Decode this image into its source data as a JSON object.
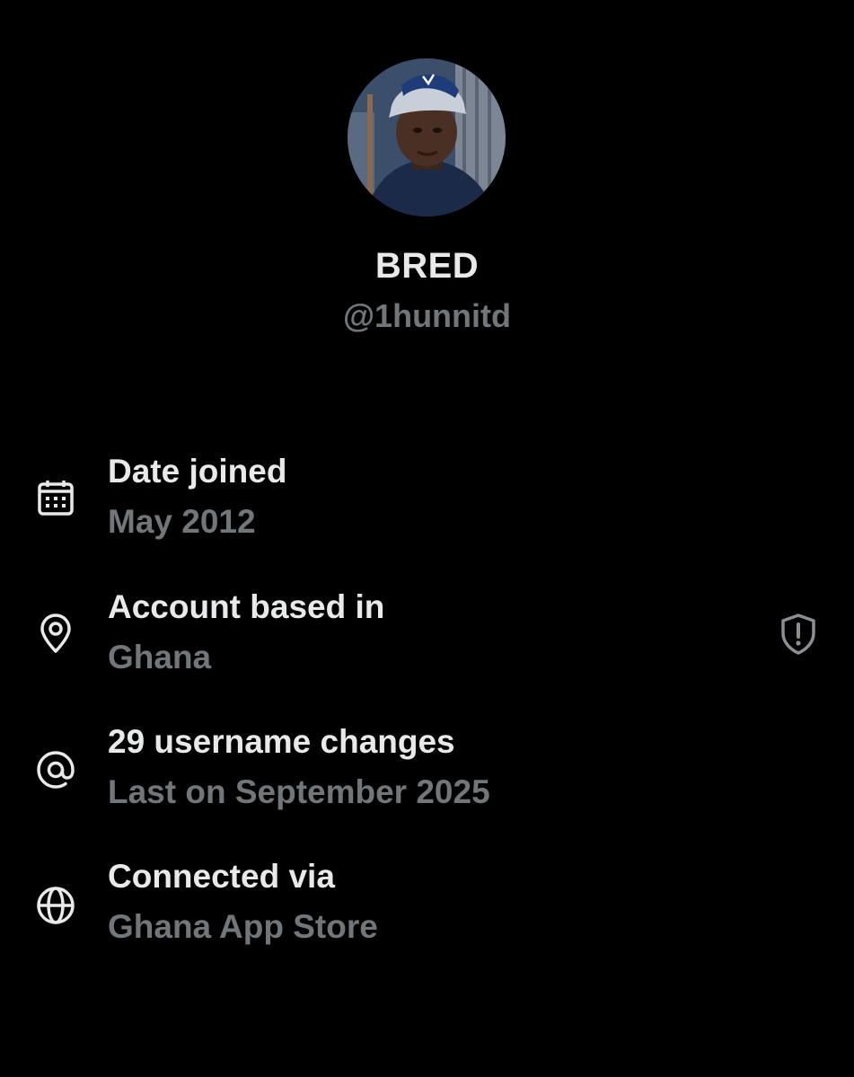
{
  "profile": {
    "display_name": "BRED",
    "handle": "@1hunnitd",
    "avatar": "profile-photo"
  },
  "about": {
    "rows": [
      {
        "icon": "calendar-icon",
        "title": "Date joined",
        "value": "May 2012"
      },
      {
        "icon": "location-pin-icon",
        "title": "Account based in",
        "value": "Ghana",
        "badge_icon": "shield-alert-icon"
      },
      {
        "icon": "at-sign-icon",
        "title": "29 username changes",
        "value": "Last on September 2025"
      },
      {
        "icon": "globe-icon",
        "title": "Connected via",
        "value": "Ghana App Store"
      }
    ]
  },
  "colors": {
    "background": "#000000",
    "primary_text": "#e7e9ea",
    "secondary_text": "#71767b",
    "icon": "#e7e9ea",
    "badge_icon": "#8b8f94"
  }
}
